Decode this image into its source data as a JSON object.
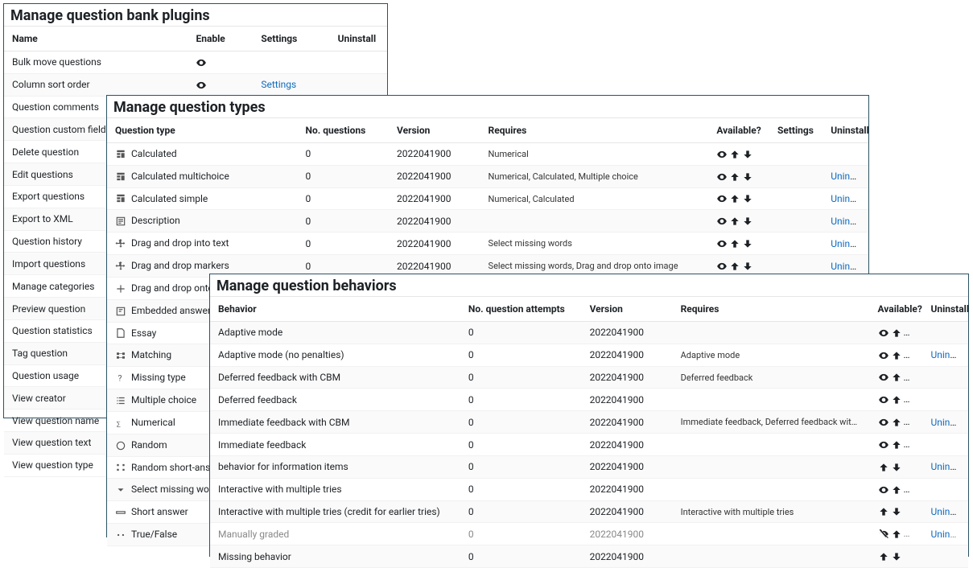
{
  "plugins_panel": {
    "title": "Manage question bank plugins",
    "headers": {
      "name": "Name",
      "enable": "Enable",
      "settings": "Settings",
      "uninstall": "Uninstall"
    },
    "rows": [
      {
        "name": "Bulk move questions",
        "settings": ""
      },
      {
        "name": "Column sort order",
        "settings": "Settings"
      },
      {
        "name": "Question comments",
        "settings": ""
      },
      {
        "name": "Question custom fields",
        "settings": ""
      },
      {
        "name": "Delete question",
        "settings": ""
      },
      {
        "name": "Edit questions",
        "settings": ""
      },
      {
        "name": "Export questions",
        "settings": ""
      },
      {
        "name": "Export to XML",
        "settings": ""
      },
      {
        "name": "Question history",
        "settings": ""
      },
      {
        "name": "Import questions",
        "settings": ""
      },
      {
        "name": "Manage categories",
        "settings": ""
      },
      {
        "name": "Preview question",
        "settings": ""
      },
      {
        "name": "Question statistics",
        "settings": ""
      },
      {
        "name": "Tag question",
        "settings": ""
      },
      {
        "name": "Question usage",
        "settings": ""
      },
      {
        "name": "View creator",
        "settings": ""
      },
      {
        "name": "View question name",
        "settings": ""
      },
      {
        "name": "View question text",
        "settings": ""
      },
      {
        "name": "View question type",
        "settings": ""
      }
    ]
  },
  "types_panel": {
    "title": "Manage question types",
    "headers": {
      "type": "Question type",
      "noq": "No. questions",
      "version": "Version",
      "requires": "Requires",
      "available": "Available?",
      "settings": "Settings",
      "uninstall": "Uninstall"
    },
    "rows": [
      {
        "icon": "calc",
        "name": "Calculated",
        "noq": "0",
        "version": "2022041900",
        "requires": "Numerical",
        "uninstall": ""
      },
      {
        "icon": "calc",
        "name": "Calculated multichoice",
        "noq": "0",
        "version": "2022041900",
        "requires": "Numerical, Calculated, Multiple choice",
        "uninstall": "Uninstall"
      },
      {
        "icon": "calc",
        "name": "Calculated simple",
        "noq": "0",
        "version": "2022041900",
        "requires": "Numerical, Calculated",
        "uninstall": "Uninstall"
      },
      {
        "icon": "desc",
        "name": "Description",
        "noq": "0",
        "version": "2022041900",
        "requires": "",
        "uninstall": "Uninstall"
      },
      {
        "icon": "drag",
        "name": "Drag and drop into text",
        "noq": "0",
        "version": "2022041900",
        "requires": "Select missing words",
        "uninstall": "Uninstall"
      },
      {
        "icon": "drag",
        "name": "Drag and drop markers",
        "noq": "0",
        "version": "2022041900",
        "requires": "Select missing words, Drag and drop onto image",
        "uninstall": "Uninstall"
      },
      {
        "icon": "plus",
        "name": "Drag and drop onto image",
        "noq": "",
        "version": "",
        "requires": "",
        "uninstall": ""
      },
      {
        "icon": "embed",
        "name": "Embedded answers (Cloze)",
        "noq": "",
        "version": "",
        "requires": "",
        "uninstall": ""
      },
      {
        "icon": "essay",
        "name": "Essay",
        "noq": "",
        "version": "",
        "requires": "",
        "uninstall": ""
      },
      {
        "icon": "match",
        "name": "Matching",
        "noq": "",
        "version": "",
        "requires": "",
        "uninstall": ""
      },
      {
        "icon": "miss",
        "name": "Missing type",
        "noq": "",
        "version": "",
        "requires": "",
        "uninstall": ""
      },
      {
        "icon": "mc",
        "name": "Multiple choice",
        "noq": "",
        "version": "",
        "requires": "",
        "uninstall": ""
      },
      {
        "icon": "num",
        "name": "Numerical",
        "noq": "",
        "version": "",
        "requires": "",
        "uninstall": ""
      },
      {
        "icon": "rand",
        "name": "Random",
        "noq": "",
        "version": "",
        "requires": "",
        "uninstall": ""
      },
      {
        "icon": "randm",
        "name": "Random short-answer matching",
        "noq": "",
        "version": "",
        "requires": "",
        "uninstall": ""
      },
      {
        "icon": "sel",
        "name": "Select missing words",
        "noq": "",
        "version": "",
        "requires": "",
        "uninstall": ""
      },
      {
        "icon": "short",
        "name": "Short answer",
        "noq": "",
        "version": "",
        "requires": "",
        "uninstall": ""
      },
      {
        "icon": "tf",
        "name": "True/False",
        "noq": "",
        "version": "",
        "requires": "",
        "uninstall": ""
      }
    ]
  },
  "behaviors_panel": {
    "title": "Manage question behaviors",
    "headers": {
      "behavior": "Behavior",
      "attempts": "No. question attempts",
      "version": "Version",
      "requires": "Requires",
      "available": "Available?",
      "uninstall": "Uninstall"
    },
    "rows": [
      {
        "name": "Adaptive mode",
        "attempts": "0",
        "version": "2022041900",
        "requires": "",
        "avail": "eud",
        "uninstall": ""
      },
      {
        "name": "Adaptive mode (no penalties)",
        "attempts": "0",
        "version": "2022041900",
        "requires": "Adaptive mode",
        "avail": "eud",
        "uninstall": "Uninstall"
      },
      {
        "name": "Deferred feedback with CBM",
        "attempts": "0",
        "version": "2022041900",
        "requires": "Deferred feedback",
        "avail": "eud",
        "uninstall": ""
      },
      {
        "name": "Deferred feedback",
        "attempts": "0",
        "version": "2022041900",
        "requires": "",
        "avail": "eud",
        "uninstall": ""
      },
      {
        "name": "Immediate feedback with CBM",
        "attempts": "0",
        "version": "2022041900",
        "requires": "Immediate feedback, Deferred feedback with CBM",
        "avail": "eud",
        "uninstall": "Uninstall"
      },
      {
        "name": "Immediate feedback",
        "attempts": "0",
        "version": "2022041900",
        "requires": "",
        "avail": "eud",
        "uninstall": ""
      },
      {
        "name": "behavior for information items",
        "attempts": "0",
        "version": "2022041900",
        "requires": "",
        "avail": "ud",
        "uninstall": "Uninstall"
      },
      {
        "name": "Interactive with multiple tries",
        "attempts": "0",
        "version": "2022041900",
        "requires": "",
        "avail": "eud",
        "uninstall": ""
      },
      {
        "name": "Interactive with multiple tries (credit for earlier tries)",
        "attempts": "0",
        "version": "2022041900",
        "requires": "Interactive with multiple tries",
        "avail": "ud",
        "uninstall": "Uninstall"
      },
      {
        "name": "Manually graded",
        "attempts": "0",
        "version": "2022041900",
        "requires": "",
        "avail": "hud",
        "dim": true,
        "uninstall": "Uninstall"
      },
      {
        "name": "Missing behavior",
        "attempts": "0",
        "version": "2022041900",
        "requires": "",
        "avail": "ud",
        "uninstall": ""
      }
    ]
  }
}
